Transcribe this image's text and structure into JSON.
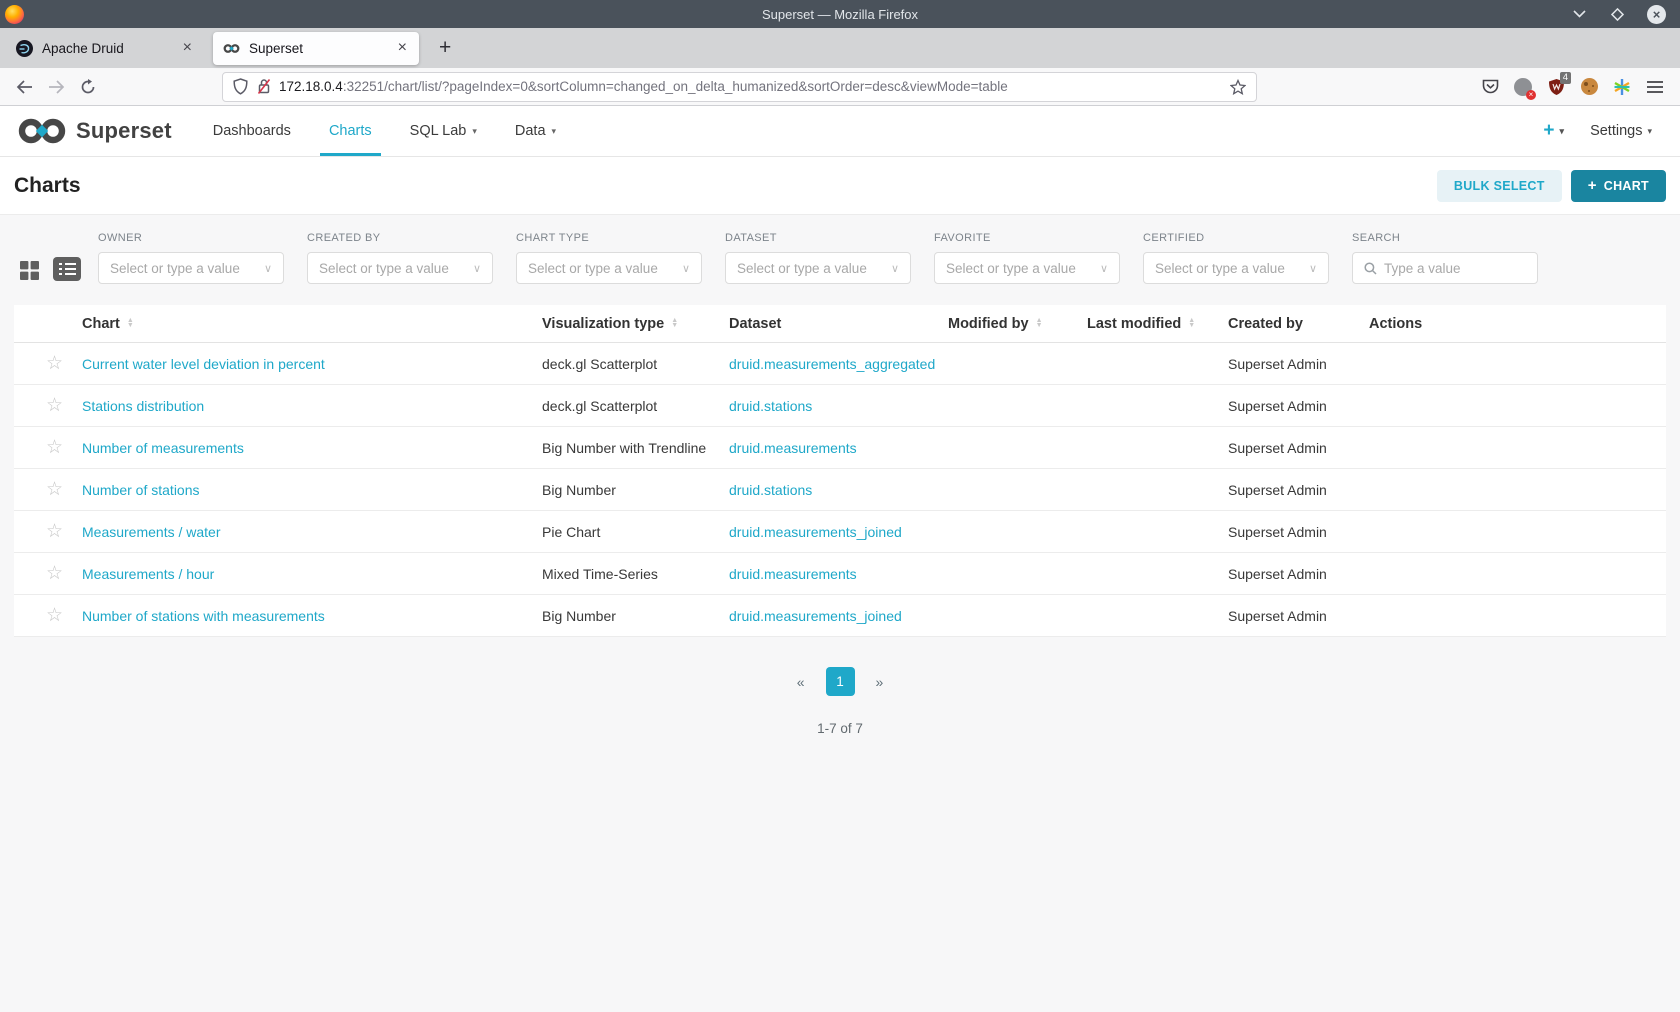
{
  "browser": {
    "window_title": "Superset — Mozilla Firefox",
    "tabs": [
      {
        "title": "Apache Druid",
        "close_glyph": "×"
      },
      {
        "title": "Superset",
        "close_glyph": "×"
      }
    ],
    "new_tab_glyph": "+",
    "url": {
      "host": "172.18.0.4",
      "rest": ":32251/chart/list/?pageIndex=0&sortColumn=changed_on_delta_humanized&sortOrder=desc&viewMode=table"
    },
    "extension_badge_count": "4",
    "window_close_glyph": "×"
  },
  "navbar": {
    "brand": "Superset",
    "items": [
      {
        "label": "Dashboards"
      },
      {
        "label": "Charts"
      },
      {
        "label": "SQL Lab",
        "caret": "▾"
      },
      {
        "label": "Data",
        "caret": "▾"
      }
    ],
    "plus_label": "+",
    "plus_caret": "▾",
    "settings_label": "Settings",
    "settings_caret": "▾"
  },
  "header": {
    "title": "Charts",
    "bulk_select_label": "BULK SELECT",
    "add_chart_plus": "+",
    "add_chart_label": "CHART"
  },
  "filters": {
    "selects": [
      {
        "label": "OWNER",
        "placeholder": "Select or type a value"
      },
      {
        "label": "CREATED BY",
        "placeholder": "Select or type a value"
      },
      {
        "label": "CHART TYPE",
        "placeholder": "Select or type a value"
      },
      {
        "label": "DATASET",
        "placeholder": "Select or type a value"
      },
      {
        "label": "FAVORITE",
        "placeholder": "Select or type a value"
      },
      {
        "label": "CERTIFIED",
        "placeholder": "Select or type a value"
      }
    ],
    "select_chevron": "∨",
    "search": {
      "label": "SEARCH",
      "placeholder": "Type a value"
    }
  },
  "table": {
    "columns": [
      {
        "label": "Chart",
        "sortable": true
      },
      {
        "label": "Visualization type",
        "sortable": true
      },
      {
        "label": "Dataset",
        "sortable": false
      },
      {
        "label": "Modified by",
        "sortable": true
      },
      {
        "label": "Last modified",
        "sortable": true
      },
      {
        "label": "Created by",
        "sortable": false
      },
      {
        "label": "Actions",
        "sortable": false
      }
    ],
    "star_glyph": "☆",
    "rows": [
      {
        "chart": "Current water level deviation in percent",
        "viz_type": "deck.gl Scatterplot",
        "dataset": "druid.measurements_aggregated",
        "modified_by": "",
        "last_modified": "",
        "created_by": "Superset Admin"
      },
      {
        "chart": "Stations distribution",
        "viz_type": "deck.gl Scatterplot",
        "dataset": "druid.stations",
        "modified_by": "",
        "last_modified": "",
        "created_by": "Superset Admin"
      },
      {
        "chart": "Number of measurements",
        "viz_type": "Big Number with Trendline",
        "dataset": "druid.measurements",
        "modified_by": "",
        "last_modified": "",
        "created_by": "Superset Admin"
      },
      {
        "chart": "Number of stations",
        "viz_type": "Big Number",
        "dataset": "druid.stations",
        "modified_by": "",
        "last_modified": "",
        "created_by": "Superset Admin"
      },
      {
        "chart": "Measurements / water",
        "viz_type": "Pie Chart",
        "dataset": "druid.measurements_joined",
        "modified_by": "",
        "last_modified": "",
        "created_by": "Superset Admin"
      },
      {
        "chart": "Measurements / hour",
        "viz_type": "Mixed Time-Series",
        "dataset": "druid.measurements",
        "modified_by": "",
        "last_modified": "",
        "created_by": "Superset Admin"
      },
      {
        "chart": "Number of stations with measurements",
        "viz_type": "Big Number",
        "dataset": "druid.measurements_joined",
        "modified_by": "",
        "last_modified": "",
        "created_by": "Superset Admin"
      }
    ]
  },
  "pagination": {
    "prev_glyph": "«",
    "active_page": "1",
    "next_glyph": "»",
    "summary": "1-7 of 7"
  },
  "colors": {
    "accent": "#1fa8c9",
    "primary_button": "#1a85a0",
    "titlebar": "#4a525b",
    "content_background": "#f7f7f8"
  }
}
